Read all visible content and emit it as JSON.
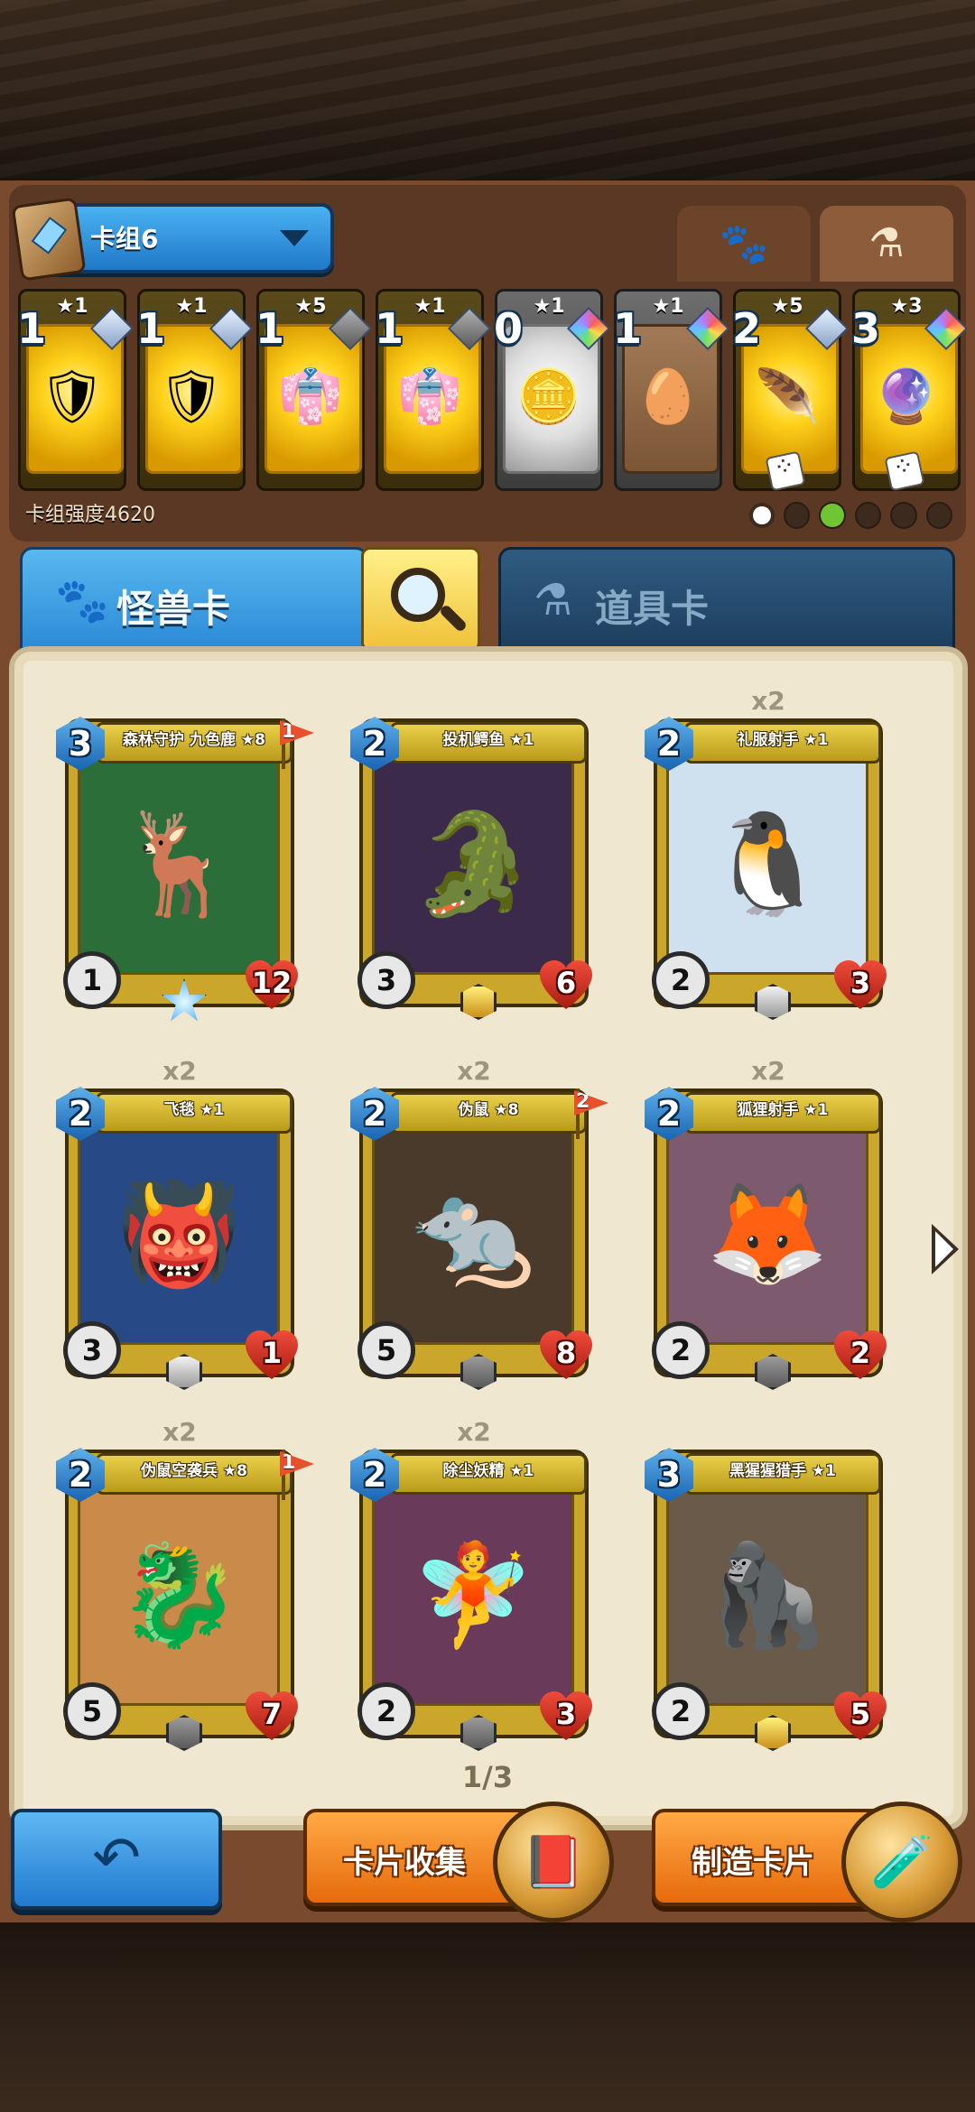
{
  "deck": {
    "name": "卡组6",
    "strength_text": "卡组强度4620"
  },
  "mode_tabs": {
    "beast_icon": "paw-icon",
    "item_icon": "flask-icon"
  },
  "equipment": [
    {
      "count": "1",
      "stars": "★1",
      "tier": "gold",
      "gem": "silver",
      "icon": "🛡"
    },
    {
      "count": "1",
      "stars": "★1",
      "tier": "gold",
      "gem": "silver",
      "icon": "🛡"
    },
    {
      "count": "1",
      "stars": "★5",
      "tier": "gold",
      "gem": "dark",
      "icon": "👘"
    },
    {
      "count": "1",
      "stars": "★1",
      "tier": "gold",
      "gem": "dark",
      "icon": "👘"
    },
    {
      "count": "0",
      "stars": "★1",
      "tier": "silver",
      "gem": "rainbow",
      "icon": "🪙"
    },
    {
      "count": "1",
      "stars": "★1",
      "tier": "bronze",
      "gem": "rainbow",
      "icon": "🥚"
    },
    {
      "count": "2",
      "stars": "★5",
      "tier": "gold",
      "gem": "silver",
      "icon": "🪶",
      "dice": true
    },
    {
      "count": "3",
      "stars": "★3",
      "tier": "gold",
      "gem": "rainbow",
      "icon": "🔮",
      "dice": true
    }
  ],
  "tabs": {
    "beast": "怪兽卡",
    "item": "道具卡"
  },
  "cards": [
    {
      "name": "森林守护 九色鹿 ★8",
      "cost": "3",
      "lvl": "1",
      "hp": "12",
      "flag": "1",
      "rarity": "starburst",
      "mult": "",
      "art": "#2c6e3a",
      "icon": "🦌"
    },
    {
      "name": "投机鳄鱼 ★1",
      "cost": "2",
      "lvl": "3",
      "hp": "6",
      "flag": "",
      "rarity": "gold",
      "mult": "",
      "art": "#3b2a4a",
      "icon": "🐊"
    },
    {
      "name": "礼服射手 ★1",
      "cost": "2",
      "lvl": "2",
      "hp": "3",
      "flag": "",
      "rarity": "silver",
      "mult": "x2",
      "art": "#cfe0ee",
      "icon": "🐧"
    },
    {
      "name": "飞毯 ★1",
      "cost": "2",
      "lvl": "3",
      "hp": "1",
      "flag": "",
      "rarity": "silver",
      "mult": "x2",
      "art": "#274a86",
      "icon": "👹"
    },
    {
      "name": "伪鼠 ★8",
      "cost": "2",
      "lvl": "5",
      "hp": "8",
      "flag": "2",
      "rarity": "dark",
      "mult": "x2",
      "art": "#4a3a2c",
      "icon": "🐀"
    },
    {
      "name": "狐狸射手 ★1",
      "cost": "2",
      "lvl": "2",
      "hp": "2",
      "flag": "",
      "rarity": "dark",
      "mult": "x2",
      "art": "#7e5a6e",
      "icon": "🦊"
    },
    {
      "name": "伪鼠空袭兵 ★8",
      "cost": "2",
      "lvl": "5",
      "hp": "7",
      "flag": "1",
      "rarity": "dark",
      "mult": "x2",
      "art": "#c98a4a",
      "icon": "🐉"
    },
    {
      "name": "除尘妖精 ★1",
      "cost": "2",
      "lvl": "2",
      "hp": "3",
      "flag": "",
      "rarity": "dark",
      "mult": "x2",
      "art": "#6a3a5a",
      "icon": "🧚"
    },
    {
      "name": "黑猩猩猎手 ★1",
      "cost": "3",
      "lvl": "2",
      "hp": "5",
      "flag": "",
      "rarity": "gold",
      "mult": "",
      "art": "#6a5a4a",
      "icon": "🦍"
    }
  ],
  "pagination": {
    "text": "1/3"
  },
  "buttons": {
    "back_icon": "back-arrow-icon",
    "collection": "卡片收集",
    "craft": "制造卡片"
  }
}
